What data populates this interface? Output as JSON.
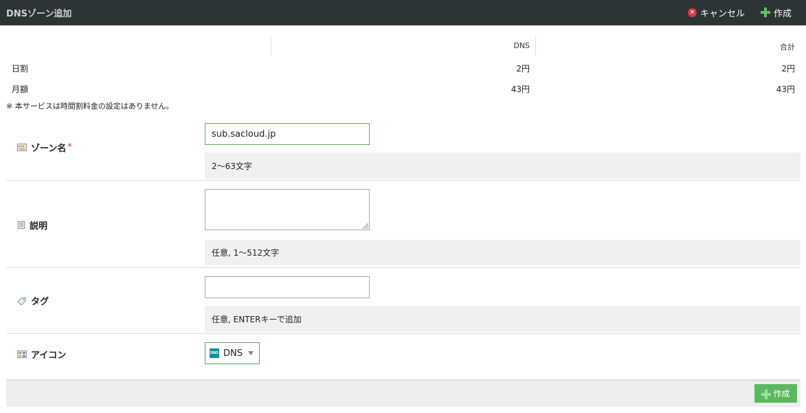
{
  "header": {
    "title": "DNSゾーン追加",
    "cancel_label": "キャンセル",
    "create_label": "作成"
  },
  "pricing": {
    "col_dns": "DNS",
    "col_total": "合計",
    "rows": [
      {
        "label": "日割",
        "dns": "2円",
        "total": "2円"
      },
      {
        "label": "月額",
        "dns": "43円",
        "total": "43円"
      }
    ],
    "note": "※ 本サービスは時間割料金の設定はありません。"
  },
  "form": {
    "zone_name": {
      "label": "ゾーン名",
      "required_mark": "*",
      "value": "sub.sacloud.jp",
      "hint": "2〜63文字"
    },
    "description": {
      "label": "説明",
      "value": "",
      "hint": "任意, 1〜512文字"
    },
    "tags": {
      "label": "タグ",
      "value": "",
      "hint": "任意, ENTERキーで追加"
    },
    "icon": {
      "label": "アイコン",
      "selected": "DNS",
      "badge": "DNS"
    }
  },
  "footer": {
    "create_label": "作成"
  },
  "colors": {
    "accent_green": "#5cb85f",
    "header_bg": "#2d3436",
    "cancel_red": "#d7363b"
  }
}
